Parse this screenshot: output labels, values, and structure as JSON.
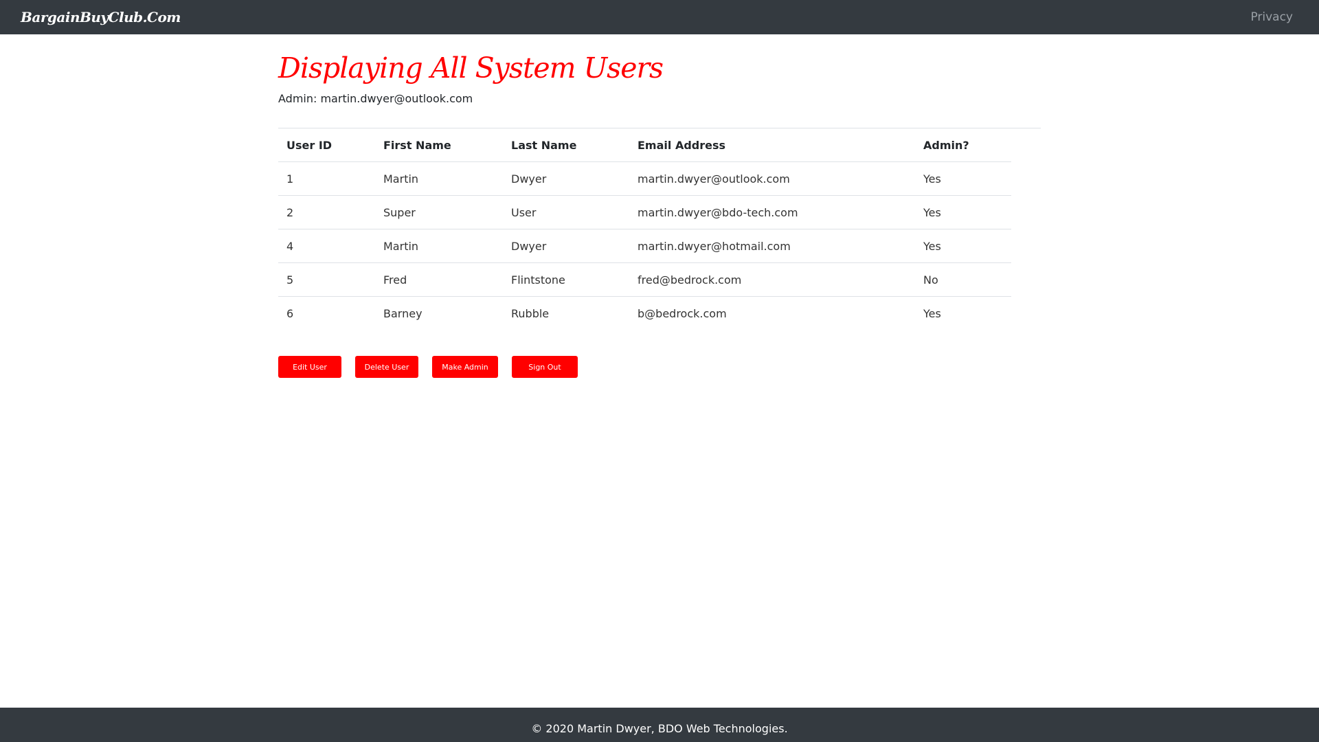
{
  "navbar": {
    "brand": "BargainBuyClub.Com",
    "privacy_label": "Privacy"
  },
  "page": {
    "title": "Displaying All System Users",
    "admin_label": "Admin: martin.dwyer@outlook.com"
  },
  "table": {
    "headers": {
      "user_id": "User ID",
      "first_name": "First Name",
      "last_name": "Last Name",
      "email": "Email Address",
      "admin": "Admin?"
    },
    "rows": [
      {
        "user_id": "1",
        "first_name": "Martin",
        "last_name": "Dwyer",
        "email": "martin.dwyer@outlook.com",
        "admin": "Yes"
      },
      {
        "user_id": "2",
        "first_name": "Super",
        "last_name": "User",
        "email": "martin.dwyer@bdo-tech.com",
        "admin": "Yes"
      },
      {
        "user_id": "4",
        "first_name": "Martin",
        "last_name": "Dwyer",
        "email": "martin.dwyer@hotmail.com",
        "admin": "Yes"
      },
      {
        "user_id": "5",
        "first_name": "Fred",
        "last_name": "Flintstone",
        "email": "fred@bedrock.com",
        "admin": "No"
      },
      {
        "user_id": "6",
        "first_name": "Barney",
        "last_name": "Rubble",
        "email": "b@bedrock.com",
        "admin": "Yes"
      }
    ]
  },
  "buttons": {
    "edit_user": "Edit User",
    "delete_user": "Delete User",
    "make_admin": "Make Admin",
    "sign_out": "Sign Out"
  },
  "footer": {
    "text": "© 2020 Martin Dwyer, BDO Web Technologies."
  },
  "colors": {
    "navbar_bg": "#343a40",
    "accent_red": "#ff0000",
    "nav_link": "#9aa0a6"
  }
}
